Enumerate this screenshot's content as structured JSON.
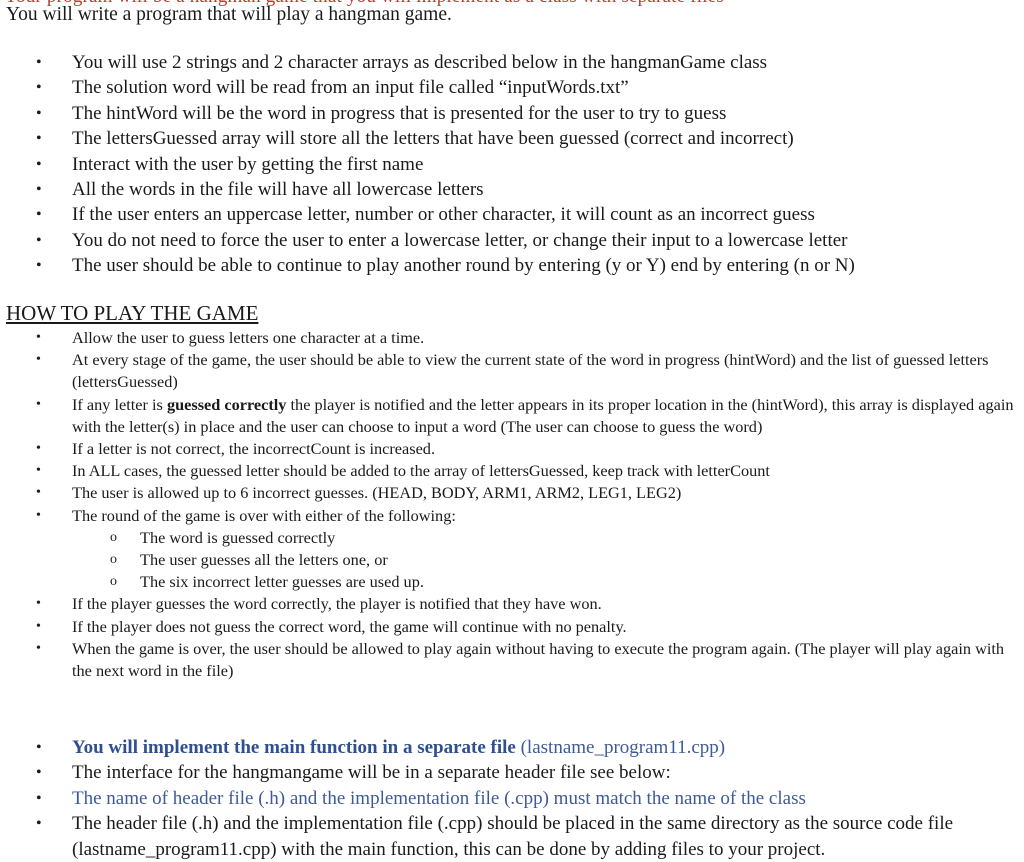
{
  "document": {
    "cutoff_top_line": "Your program will be a hangman game that you will implement as a class with separate files",
    "intro": "You will write a program that will play a hangman game.",
    "requirements": [
      "You will use 2 strings and 2 character arrays as described below in the hangmanGame class",
      "The solution word  will be read from an input file called “inputWords.txt”",
      "The hintWord will be the word in progress that is presented for the user to try to guess",
      "The lettersGuessed array will store all the letters that have been guessed (correct and incorrect)",
      "Interact with the user by getting the first name",
      "All the words in the file will have all lowercase letters",
      "If the user enters an uppercase letter,  number or other character, it will count as an incorrect guess",
      "You do not need to force the user to enter a lowercase letter, or change their input to a lowercase letter",
      "The user should be able to continue to play another round by entering (y or Y) end by entering (n or N)"
    ],
    "howto": {
      "heading": "HOW TO PLAY THE GAME",
      "items": [
        {
          "text": "Allow the user to guess letters one character at a time."
        },
        {
          "text": "At every stage of the game, the user should be able to view the current state of the word in progress (hintWord) and the list of guessed letters (lettersGuessed)"
        },
        {
          "pre": "If any letter is ",
          "bold": "guessed correctly",
          "post": " the player is notified and the letter appears in its proper location in the (hintWord), this array is displayed again with the letter(s) in place and the user can choose to input a word (The user can choose to guess the word)"
        },
        {
          "text": "If a letter is not correct, the incorrectCount is increased."
        },
        {
          "text": "In ALL cases, the guessed letter should be added to the array of lettersGuessed, keep track with letterCount"
        },
        {
          "text": "The user is allowed up to 6 incorrect guesses. (HEAD,  BODY,  ARM1,  ARM2,  LEG1, LEG2)"
        },
        {
          "text": "The round of the game is over with either of the following:"
        },
        {
          "text": "If the player guesses the word correctly, the player is notified that they have won."
        },
        {
          "text": "If the player does not guess the correct word, the game will continue with no penalty."
        },
        {
          "text": "When the game is over, the user should be allowed to play again without having to execute the program again. (The player will play again with the next word in the file)"
        }
      ],
      "end_conditions": [
        "The word is guessed correctly",
        "The user guesses all the letters one, or",
        "The six incorrect letter guesses are used up."
      ]
    },
    "files": [
      {
        "bold": "You will implement the main function in a separate file",
        "post": " (lastname_program11.cpp)"
      },
      {
        "text": "The interface for the hangmangame will be in a separate header file see below:"
      },
      {
        "text": "The name of  header file (.h) and the implementation file (.cpp) must match the name of the class"
      },
      {
        "text": "The header file (.h) and the implementation file (.cpp) should be placed in the same directory as the source code file  (lastname_program11.cpp) with the main function, this can be done by adding files to your project."
      }
    ],
    "bullet_glyph": "•",
    "sub_bullet_glyph": "o",
    "colors": {
      "text": "#1a1a1a",
      "accent_blue": "#3d5a98",
      "cutoff_red": "#c0392b"
    }
  }
}
